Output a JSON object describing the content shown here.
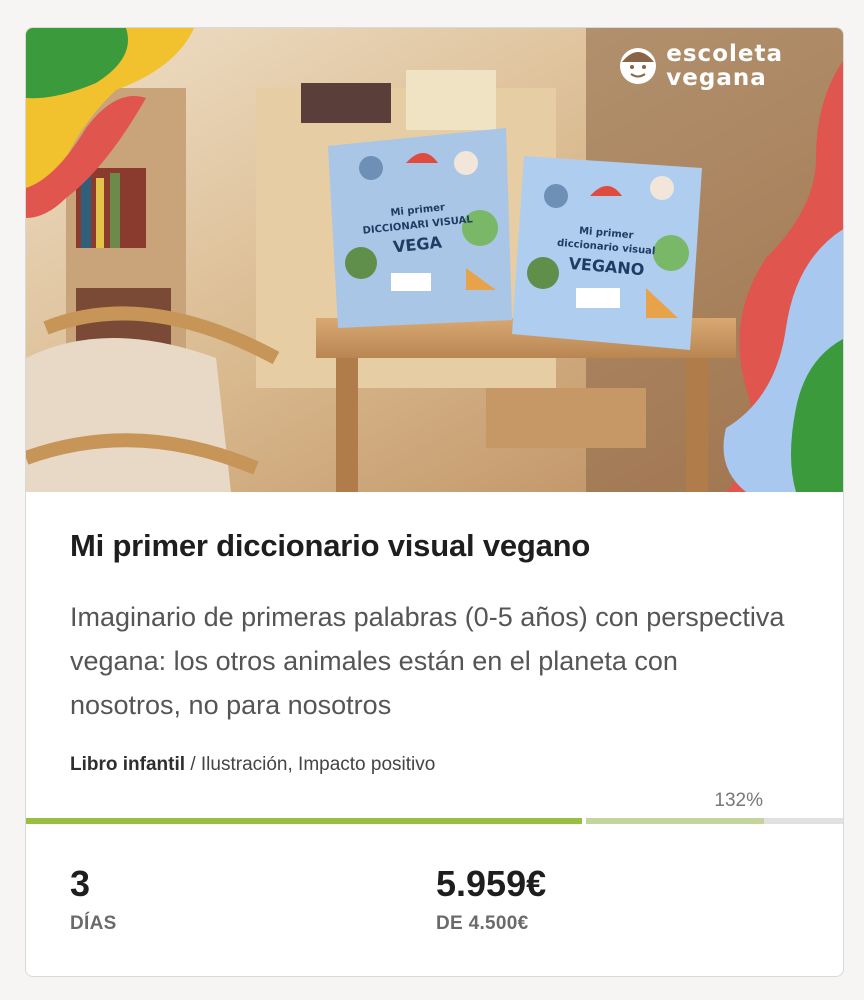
{
  "card": {
    "title": "Mi primer diccionario visual vegano",
    "description": "Imaginario de primeras palabras (0-5 años) con perspectiva vegana: los otros animales están en el planeta con nosotros, no para nosotros",
    "category": "Libro infantil",
    "tag_separator": " / ",
    "tags": "Ilustración, Impacto positivo",
    "percent_label": "132%",
    "progress_percent": 132
  },
  "image": {
    "logo_line1": "escoleta",
    "logo_line2": "vegana",
    "book_left": {
      "line1": "Mi primer",
      "line2": "DICCIONARI VISUAL",
      "line3": "VEGA"
    },
    "book_right": {
      "line1": "Mi primer",
      "line2": "diccionario visual",
      "line3": "VEGANO"
    }
  },
  "stats": {
    "days_value": "3",
    "days_label": "DÍAS",
    "raised_value": "5.959€",
    "goal_label": "DE 4.500€"
  },
  "colors": {
    "progress_funded": "#98bf3f",
    "progress_over": "#c3d59a",
    "progress_track": "#e1e1e1",
    "blob_green": "#3a9a3c",
    "blob_yellow": "#f2c12e",
    "blob_red": "#e0564e",
    "blob_blue": "#a9c8ef"
  }
}
